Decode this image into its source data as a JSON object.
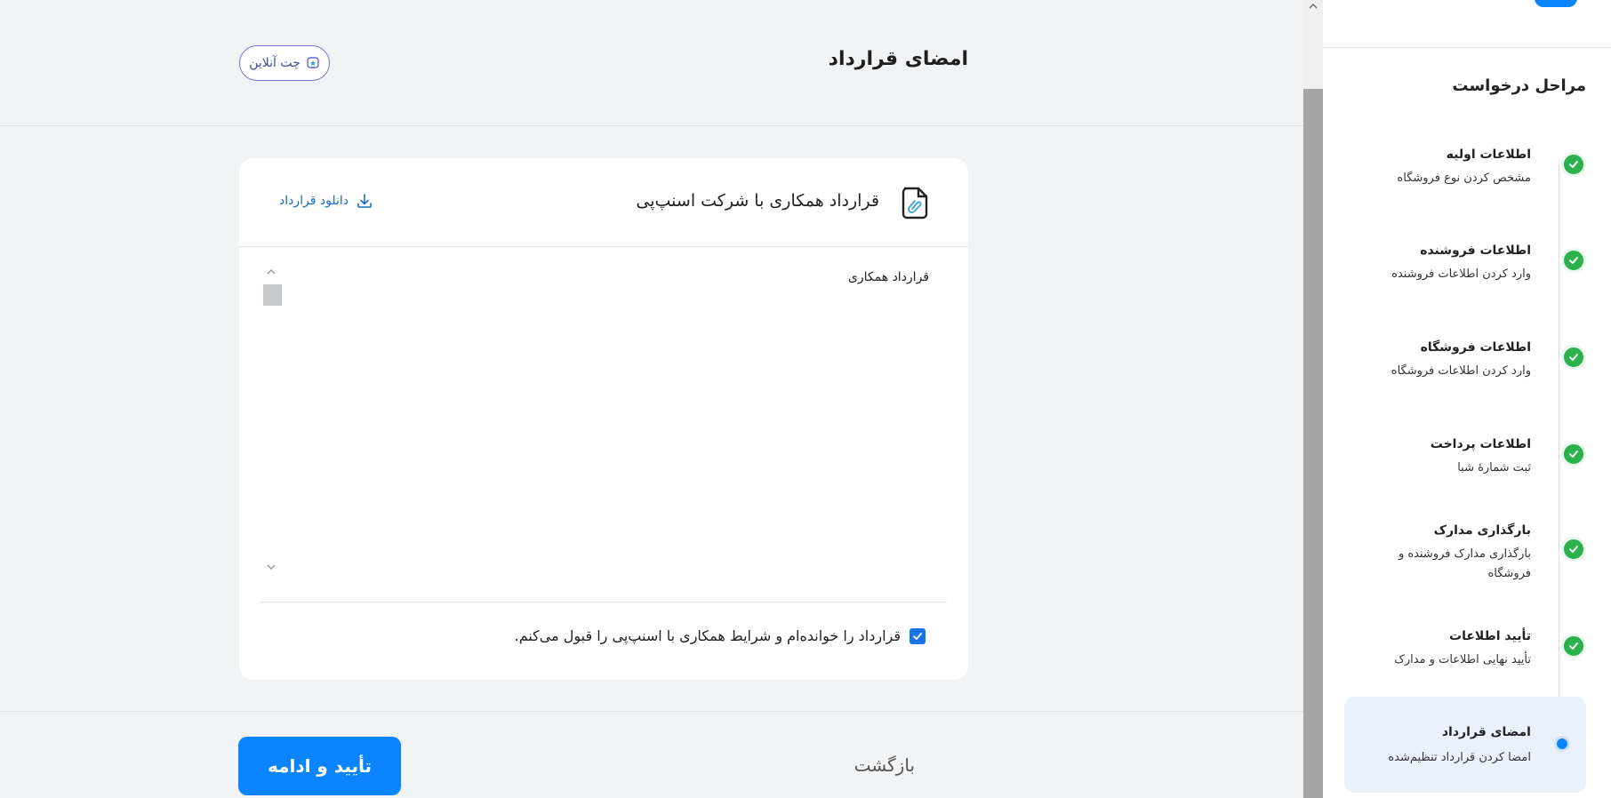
{
  "header": {
    "title": "امضای قرارداد",
    "chat_label": "چت آنلاین"
  },
  "card": {
    "title": "قرارداد همکاری با شرکت اسنپ‌پی",
    "download_label": "دانلود قرارداد",
    "contract_text": "قرارداد همکاری",
    "agree_label": "قرارداد را خوانده‌ام و شرایط همکاری با اسنپ‌پی را قبول می‌کنم.",
    "agree_checked": true
  },
  "footer": {
    "back_label": "بازگشت",
    "confirm_label": "تأیید و ادامه"
  },
  "sidebar": {
    "title": "مراحل درخواست",
    "steps": [
      {
        "name": "اطلاعات اولیه",
        "desc": "مشخص کردن نوع فروشگاه",
        "status": "done"
      },
      {
        "name": "اطلاعات فروشنده",
        "desc": "وارد کردن اطلاعات فروشنده",
        "status": "done"
      },
      {
        "name": "اطلاعات فروشگاه",
        "desc": "وارد کردن اطلاعات فروشگاه",
        "status": "done"
      },
      {
        "name": "اطلاعات پرداخت",
        "desc": "ثبت شمارهٔ شبا",
        "status": "done"
      },
      {
        "name": "بارگذاری مدارک",
        "desc": "بارگذاری مدارک فروشنده و فروشگاه",
        "status": "done"
      },
      {
        "name": "تأیید اطلاعات",
        "desc": "تأیید نهایی اطلاعات و مدارک",
        "status": "done"
      },
      {
        "name": "امضای قرارداد",
        "desc": "امضا کردن قرارداد تنظیم‌شده",
        "status": "active"
      }
    ]
  },
  "colors": {
    "primary": "#0a84ff",
    "success": "#2bb24c",
    "link": "#1a6fc4",
    "active_bg": "#e8f1fc"
  },
  "icons": [
    "chat-icon",
    "document-icon",
    "download-icon",
    "check-icon",
    "chevron-up-icon",
    "chevron-down-icon"
  ]
}
